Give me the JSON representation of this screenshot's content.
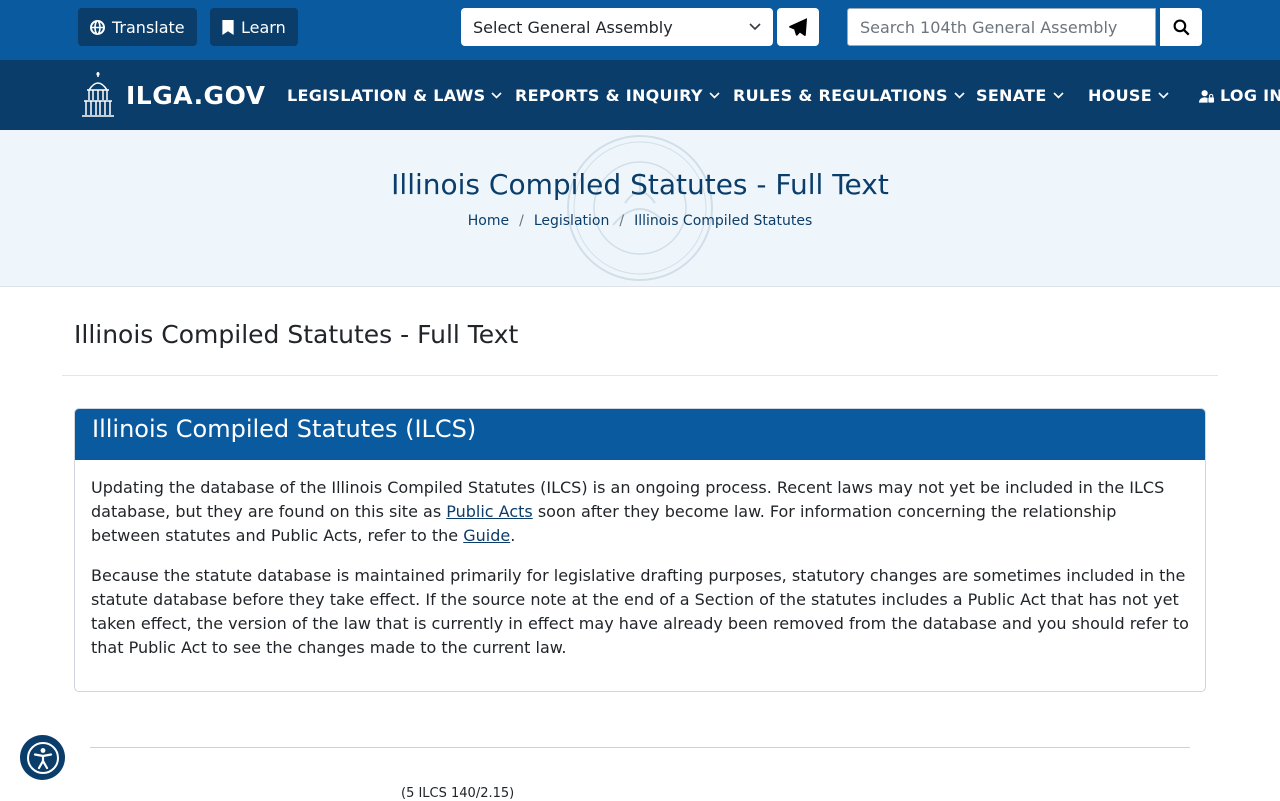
{
  "topbar": {
    "translate_label": "Translate",
    "learn_label": "Learn",
    "ga_select_value": "Select General Assembly",
    "search_placeholder": "Search 104th General Assembly"
  },
  "nav": {
    "logo_text": "ILGA.GOV",
    "items": [
      {
        "label": "LEGISLATION & LAWS"
      },
      {
        "label": "REPORTS & INQUIRY"
      },
      {
        "label": "RULES & REGULATIONS"
      },
      {
        "label": "SENATE"
      },
      {
        "label": "HOUSE"
      }
    ],
    "login_label": "LOG IN"
  },
  "hero": {
    "title": "Illinois Compiled Statutes - Full Text",
    "breadcrumb": [
      "Home",
      "Legislation",
      "Illinois Compiled Statutes"
    ]
  },
  "main": {
    "heading": "Illinois Compiled Statutes - Full Text",
    "card": {
      "title": "Illinois Compiled Statutes (ILCS)",
      "p1_a": "Updating the database of the Illinois Compiled Statutes (ILCS) is an ongoing process. Recent laws may not yet be included in the ILCS database, but they are found on this site as ",
      "p1_link1": "Public Acts",
      "p1_b": " soon after they become law. For information concerning the relationship between statutes and Public Acts, refer to the ",
      "p1_link2": "Guide",
      "p1_c": ".",
      "p2": "Because the statute database is maintained primarily for legislative drafting purposes, statutory changes are sometimes included in the statute database before they take effect. If the source note at the end of a Section of the statutes includes a Public Act that has not yet taken effect, the version of the law that is currently in effect may have already been removed from the database and you should refer to that Public Act to see the changes made to the current law."
    },
    "citation": "(5 ILCS 140/2.15)"
  }
}
